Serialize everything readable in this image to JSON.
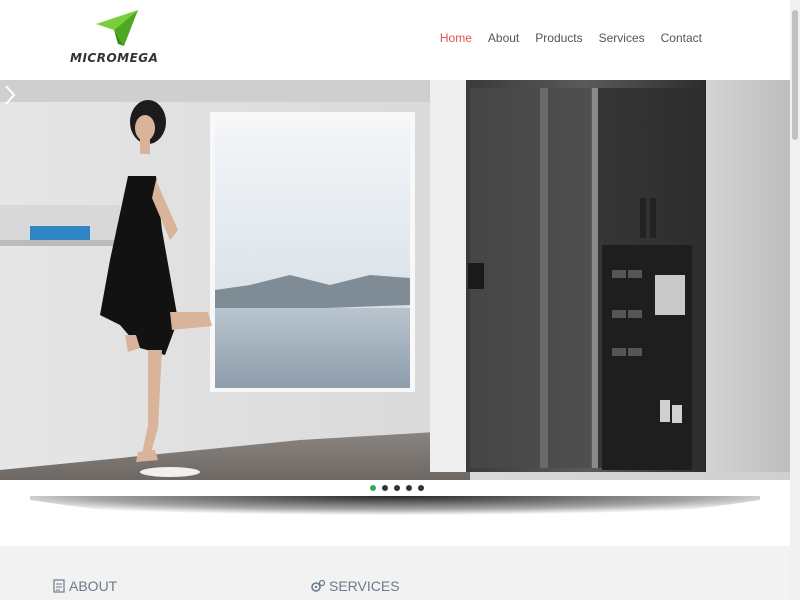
{
  "brand": {
    "name": "MICROMEGA",
    "logo_color": "#5dbb2e"
  },
  "nav": {
    "items": [
      {
        "label": "Home",
        "active": true
      },
      {
        "label": "About",
        "active": false
      },
      {
        "label": "Products",
        "active": false
      },
      {
        "label": "Services",
        "active": false
      },
      {
        "label": "Contact",
        "active": false
      }
    ],
    "active_color": "#e0524d"
  },
  "slider": {
    "slide_count": 5,
    "active_index": 0,
    "next_icon": "chevron-right-icon",
    "active_dot_color": "#2eab5e"
  },
  "sections": {
    "about": {
      "title": "ABOUT",
      "icon": "document-icon"
    },
    "services": {
      "title": "SERVICES",
      "icon": "gears-icon"
    }
  }
}
